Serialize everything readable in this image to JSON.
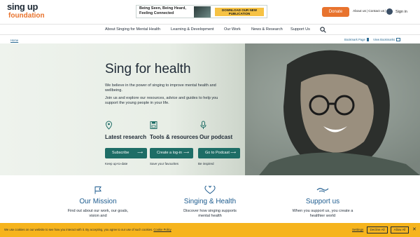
{
  "logo": {
    "line1": "sing up",
    "line2": "foundation"
  },
  "banner": {
    "title": "Being Seen, Being Heard, Feeling Connected",
    "cta": "DOWNLOAD OUR NEW PUBLICATION"
  },
  "header": {
    "donate": "Donate",
    "about": "About us",
    "contact": "Contact us",
    "signin": "Sign in"
  },
  "nav": [
    "About Singing for Mental Health",
    "Learning & Development",
    "Our Work",
    "News & Research",
    "Support Us"
  ],
  "breadcrumb": {
    "home": "Home"
  },
  "bookmarks": {
    "bookmark_page": "Bookmark Page",
    "view_bookmarks": "View Bookmarks"
  },
  "hero": {
    "title": "Sing for health",
    "para1": "We believe in the power of singing to improve mental health and wellbeing.",
    "para2": "Join us and explore our resources, advice and guides to help you support the young people in your life.",
    "features": [
      {
        "label": "Latest research",
        "icon": "map-pin-icon"
      },
      {
        "label": "Tools & resources",
        "icon": "save-icon"
      },
      {
        "label": "Our podcast",
        "icon": "microphone-icon"
      }
    ],
    "buttons": [
      {
        "label": "Subscribe",
        "caption": "Keep up-to-date"
      },
      {
        "label": "Create a log-in",
        "caption": "Save your favourites"
      },
      {
        "label": "Go to Podcast",
        "caption": "Be inspired"
      }
    ]
  },
  "sections": [
    {
      "title": "Our Mission",
      "text": "Find out about our work, our goals, vision and",
      "icon": "flag-icon"
    },
    {
      "title": "Singing & Health",
      "text": "Discover how singing supports mental health",
      "icon": "heart-icon"
    },
    {
      "title": "Support us",
      "text": "When you support us, you create a healthier world",
      "icon": "handshake-icon"
    }
  ],
  "cookie": {
    "text": "We use cookies on our website to see how you interact with it. By accepting, you agree to our use of such cookies.",
    "policy": "Cookie Policy",
    "settings": "Settings",
    "decline": "Decline All",
    "allow": "Allow All"
  },
  "colors": {
    "accent": "#e8732e",
    "teal": "#1e6d66",
    "blue": "#1e5c8f",
    "cookie": "#f6b41d"
  }
}
